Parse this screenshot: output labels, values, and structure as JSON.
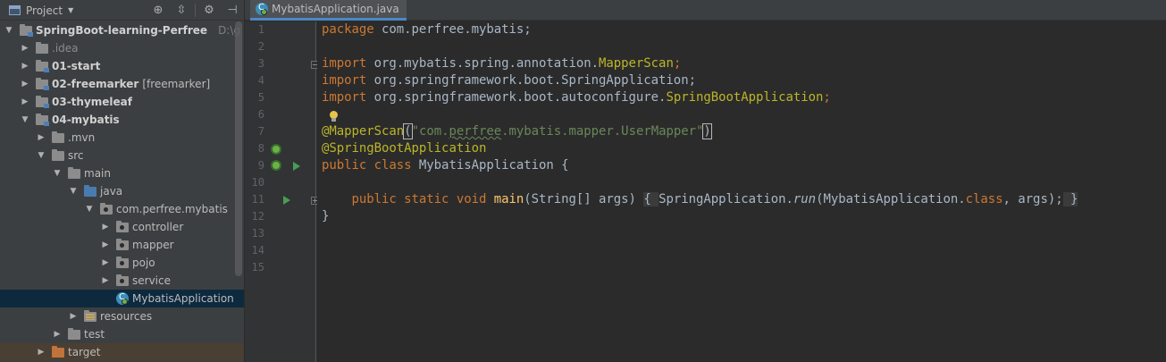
{
  "project_panel": {
    "title": "Project",
    "tools": [
      "target-icon",
      "collapse-icon",
      "gear-icon",
      "hide-icon"
    ]
  },
  "tree": [
    {
      "depth": 0,
      "arrow": "down",
      "icon": "module",
      "label": "SpringBoot-learning-Perfree",
      "bold": true,
      "path": "D:\\g"
    },
    {
      "depth": 1,
      "arrow": "right",
      "icon": "folder",
      "label": ".idea",
      "muted": true
    },
    {
      "depth": 1,
      "arrow": "right",
      "icon": "module",
      "label": "01-start",
      "bold": true
    },
    {
      "depth": 1,
      "arrow": "right",
      "icon": "module",
      "label": "02-freemarker",
      "bold": true,
      "extra": "[freemarker]"
    },
    {
      "depth": 1,
      "arrow": "right",
      "icon": "module",
      "label": "03-thymeleaf",
      "bold": true
    },
    {
      "depth": 1,
      "arrow": "down",
      "icon": "module",
      "label": "04-mybatis",
      "bold": true
    },
    {
      "depth": 2,
      "arrow": "right",
      "icon": "folder",
      "label": ".mvn"
    },
    {
      "depth": 2,
      "arrow": "down",
      "icon": "folder",
      "label": "src"
    },
    {
      "depth": 3,
      "arrow": "down",
      "icon": "folder",
      "label": "main"
    },
    {
      "depth": 4,
      "arrow": "down",
      "icon": "blue",
      "label": "java"
    },
    {
      "depth": 5,
      "arrow": "down",
      "icon": "pkg",
      "label": "com.perfree.mybatis"
    },
    {
      "depth": 6,
      "arrow": "right",
      "icon": "pkg",
      "label": "controller"
    },
    {
      "depth": 6,
      "arrow": "right",
      "icon": "pkg",
      "label": "mapper"
    },
    {
      "depth": 6,
      "arrow": "right",
      "icon": "pkg",
      "label": "pojo"
    },
    {
      "depth": 6,
      "arrow": "right",
      "icon": "pkg",
      "label": "service"
    },
    {
      "depth": 6,
      "arrow": "none",
      "icon": "class",
      "label": "MybatisApplication",
      "selected": true
    },
    {
      "depth": 4,
      "arrow": "right",
      "icon": "res",
      "label": "resources"
    },
    {
      "depth": 3,
      "arrow": "right",
      "icon": "folder",
      "label": "test"
    },
    {
      "depth": 2,
      "arrow": "right",
      "icon": "orange",
      "label": "target",
      "dim": true
    }
  ],
  "editor": {
    "tab_label": "MybatisApplication.java",
    "line_numbers": [
      "1",
      "2",
      "3",
      "4",
      "5",
      "6",
      "7",
      "8",
      "9",
      "10",
      "11",
      "12",
      "13",
      "14",
      "15"
    ],
    "lines": {
      "l1_kw": "package",
      "l1_rest": " com.perfree.mybatis;",
      "l3_kw": "import",
      "l3_pkg": " org.mybatis.spring.annotation.",
      "l3_cls": "MapperScan",
      "l3_end": ";",
      "l4_kw": "import",
      "l4_rest": " org.springframework.boot.SpringApplication;",
      "l5_kw": "import",
      "l5_pkg": " org.springframework.boot.autoconfigure.",
      "l5_cls": "SpringBootApplication",
      "l5_end": ";",
      "l7_ann": "@MapperScan",
      "l7_open": "(",
      "l7_str_a": "\"com.",
      "l7_str_b": "perfree",
      "l7_str_c": ".mybatis.mapper.UserMapper\"",
      "l7_close": ")",
      "l8_ann": "@SpringBootApplication",
      "l9_kw": "public class",
      "l9_rest": " MybatisApplication {",
      "l11_indent": "    ",
      "l11_kw": "public static void",
      "l11_sp": " ",
      "l11_fn": "main",
      "l11_args": "(String[] args)",
      "l11_sp2": " ",
      "l11_ob": "{ ",
      "l11_cls": "SpringApplication.",
      "l11_run": "run",
      "l11_call": "(MybatisApplication.",
      "l11_kw2": "class",
      "l11_tail": ", args);",
      "l11_cb": " }",
      "l12_brace": "}"
    }
  },
  "colors": {
    "keyword": "#cc7832",
    "annotation": "#bbb529",
    "string": "#6a8759",
    "function": "#ffc66d",
    "plain": "#a9b7c6",
    "selection": "#0d293e"
  }
}
